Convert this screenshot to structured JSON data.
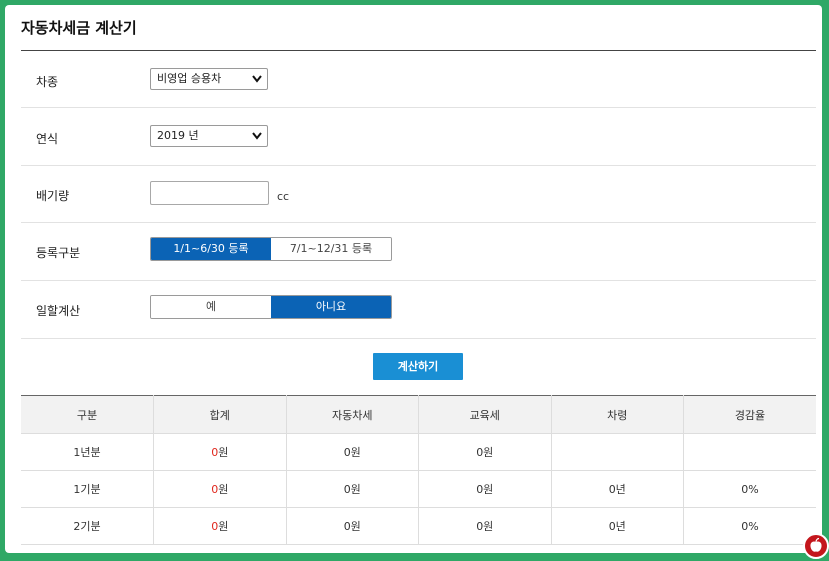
{
  "page": {
    "title": "자동차세금 계산기"
  },
  "form": {
    "car_type": {
      "label": "차종",
      "value": "비영업 승용차"
    },
    "year": {
      "label": "연식",
      "value": "2019 년"
    },
    "displacement": {
      "label": "배기량",
      "value": "",
      "unit": "cc"
    },
    "registration": {
      "label": "등록구분",
      "options": [
        "1/1~6/30 등록",
        "7/1~12/31 등록"
      ],
      "selected": 0
    },
    "daily_calc": {
      "label": "일할계산",
      "options": [
        "예",
        "아니요"
      ],
      "selected": 1
    }
  },
  "calculate_button": "계산하기",
  "result_table": {
    "headers": [
      "구분",
      "합계",
      "자동차세",
      "교육세",
      "차령",
      "경감율"
    ],
    "rows": [
      {
        "period": "1년분",
        "total_num": "0",
        "total_unit": "원",
        "car_tax": "0원",
        "edu_tax": "0원",
        "age": "",
        "reduction": ""
      },
      {
        "period": "1기분",
        "total_num": "0",
        "total_unit": "원",
        "car_tax": "0원",
        "edu_tax": "0원",
        "age": "0년",
        "reduction": "0%"
      },
      {
        "period": "2기분",
        "total_num": "0",
        "total_unit": "원",
        "car_tax": "0원",
        "edu_tax": "0원",
        "age": "0년",
        "reduction": "0%"
      }
    ]
  },
  "colors": {
    "background": "#2fa866",
    "accent": "#0b63b5",
    "button": "#1a8fd4",
    "highlight": "#e0281e"
  },
  "icons": {
    "dropdown": "chevron-down-icon",
    "logo": "brand-logo-icon"
  }
}
